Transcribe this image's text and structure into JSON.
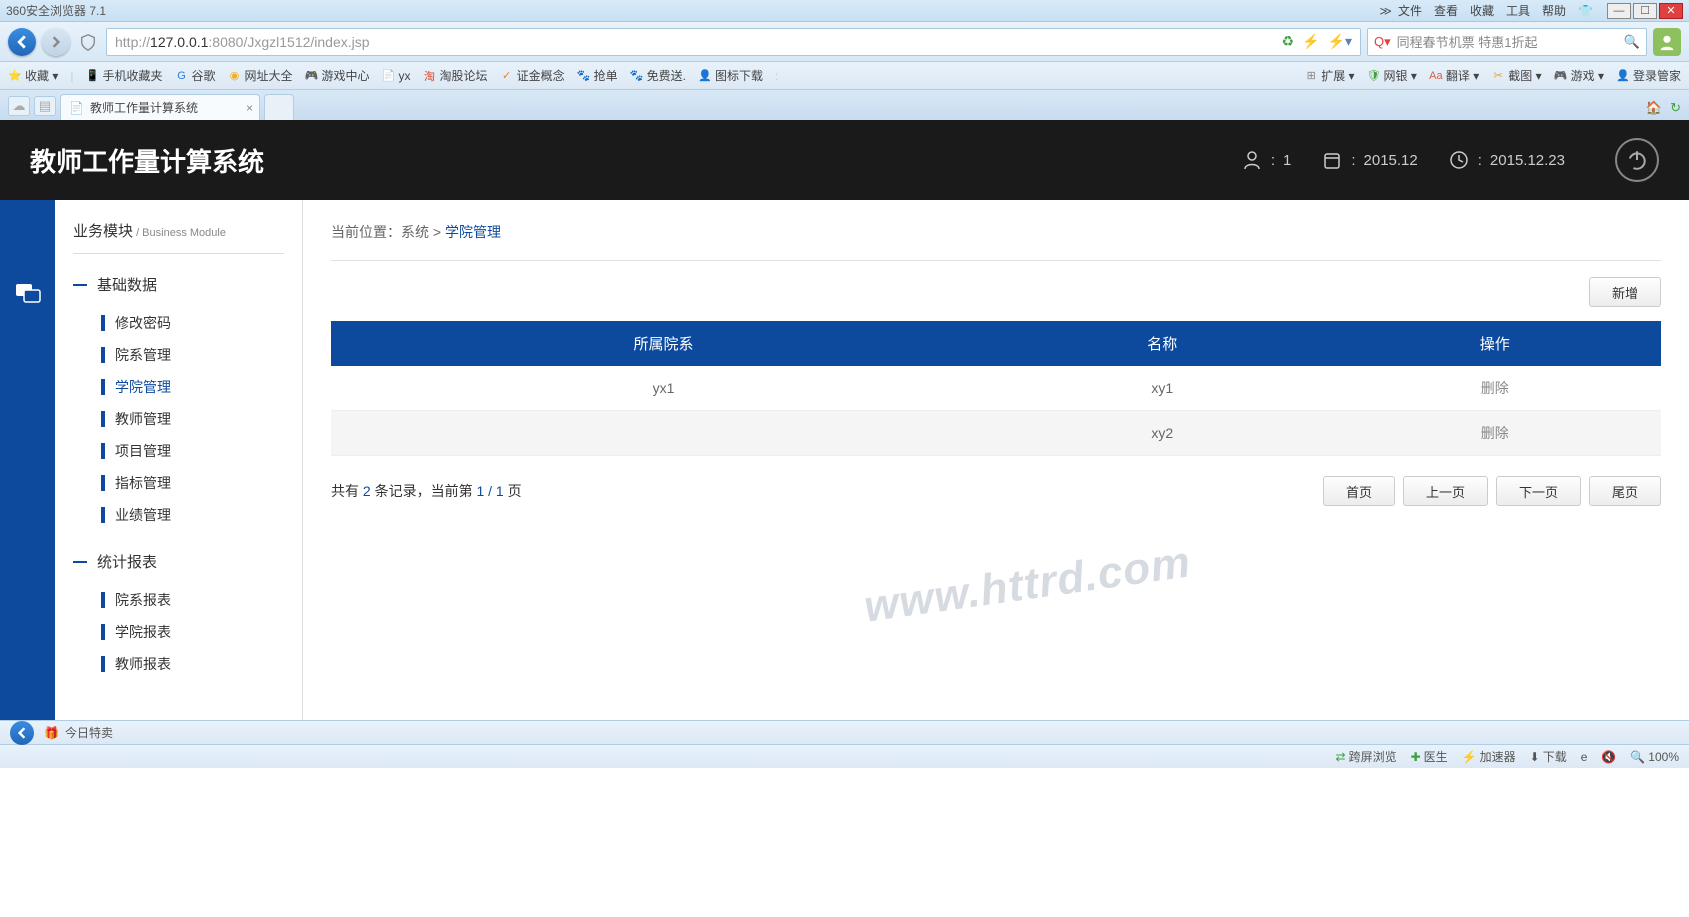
{
  "browser": {
    "title": "360安全浏览器 7.1",
    "menus": [
      "文件",
      "查看",
      "收藏",
      "工具",
      "帮助"
    ],
    "url_proto": "http://",
    "url_host": "127.0.0.1",
    "url_path": ":8080/Jxgzl1512/index.jsp",
    "search_placeholder": "同程春节机票 特惠1折起",
    "bookmarks_left": [
      {
        "icon": "⭐",
        "label": "收藏 ▾",
        "color": "#f0a020"
      },
      {
        "icon": "📱",
        "label": "手机收藏夹",
        "color": "#e06040"
      },
      {
        "icon": "G",
        "label": "谷歌",
        "color": "#2a7de0"
      },
      {
        "icon": "◉",
        "label": "网址大全",
        "color": "#f0b020"
      },
      {
        "icon": "🎮",
        "label": "游戏中心",
        "color": "#888"
      },
      {
        "icon": "📄",
        "label": "yx",
        "color": "#888"
      },
      {
        "icon": "淘",
        "label": "淘股论坛",
        "color": "#e04020"
      },
      {
        "icon": "✓",
        "label": "证金概念",
        "color": "#f08020"
      },
      {
        "icon": "🐾",
        "label": "抢单",
        "color": "#4060c0"
      },
      {
        "icon": "🐾",
        "label": "免费送.",
        "color": "#4060c0"
      },
      {
        "icon": "👤",
        "label": "图标下载",
        "color": "#333"
      }
    ],
    "bookmarks_right": [
      {
        "icon": "⊞",
        "label": "扩展 ▾",
        "color": "#888"
      },
      {
        "icon": "🛡",
        "label": "网银 ▾",
        "color": "#40a040"
      },
      {
        "icon": "Aa",
        "label": "翻译 ▾",
        "color": "#e06040"
      },
      {
        "icon": "✂",
        "label": "截图 ▾",
        "color": "#f0a020"
      },
      {
        "icon": "🎮",
        "label": "游戏 ▾",
        "color": "#888"
      },
      {
        "icon": "👤",
        "label": "登录管家",
        "color": "#e06040"
      }
    ],
    "tab_title": "教师工作量计算系统"
  },
  "header": {
    "title": "教师工作量计算系统",
    "user_count": "1",
    "cal_value": "2015.12",
    "date_value": "2015.12.23"
  },
  "sidebar": {
    "title_zh": "业务模块",
    "title_en": " / Business Module",
    "groups": [
      {
        "label": "基础数据",
        "items": [
          "修改密码",
          "院系管理",
          "学院管理",
          "教师管理",
          "项目管理",
          "指标管理",
          "业绩管理"
        ],
        "active_index": 2
      },
      {
        "label": "统计报表",
        "items": [
          "院系报表",
          "学院报表",
          "教师报表"
        ],
        "active_index": -1
      }
    ]
  },
  "breadcrumb": {
    "prefix": "当前位置：系统 > ",
    "current": "学院管理"
  },
  "actions": {
    "add": "新增"
  },
  "table": {
    "headers": [
      "所属院系",
      "名称",
      "操作"
    ],
    "rows": [
      {
        "dept": "yx1",
        "name": "xy1",
        "op": "删除"
      },
      {
        "dept": "",
        "name": "xy2",
        "op": "删除"
      }
    ]
  },
  "pager": {
    "text_pre": "共有 ",
    "total": "2",
    "text_mid": " 条记录，当前第 ",
    "page": "1 / 1",
    "text_post": " 页",
    "buttons": [
      "首页",
      "上一页",
      "下一页",
      "尾页"
    ]
  },
  "watermark": "www.httrd.com",
  "footer": {
    "today": "今日特卖",
    "items": [
      "跨屏浏览",
      "医生",
      "加速器",
      "下载",
      "",
      "",
      "100%"
    ],
    "cross_icon": "⇄",
    "doctor_icon": "✚",
    "accel_icon": "⚡",
    "dl_icon": "⬇",
    "mute_icon": "🔇",
    "zoom_icon": "🔍"
  }
}
